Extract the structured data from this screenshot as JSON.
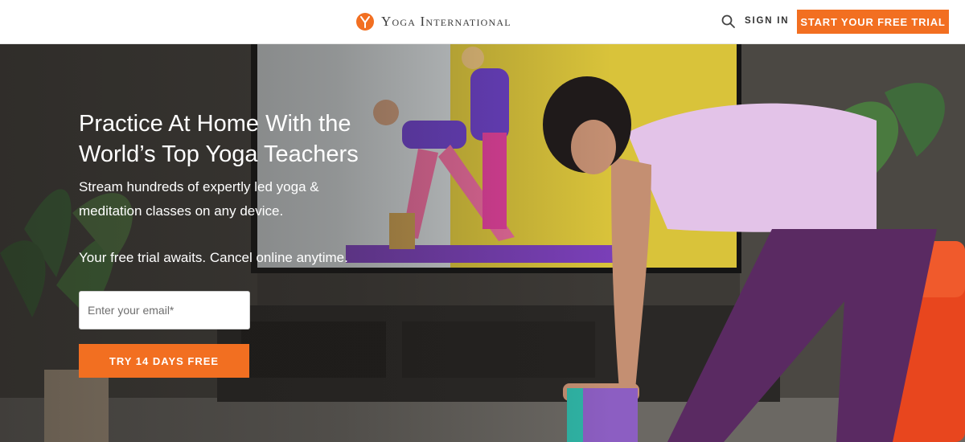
{
  "header": {
    "brand": "Yoga International",
    "sign_in_label": "SIGN IN",
    "trial_button_label": "START YOUR FREE TRIAL"
  },
  "hero": {
    "title": "Practice At Home With the World’s Top Yoga Teachers",
    "subtitle": "Stream hundreds of expertly led yoga & meditation classes on any device.",
    "trial_note": "Your free trial awaits. Cancel online anytime.",
    "email_placeholder": "Enter your email*",
    "cta_label": "TRY 14 DAYS FREE"
  },
  "colors": {
    "accent": "#f26f21",
    "text_dark": "#333333",
    "header_bg": "#ffffff"
  },
  "icons": {
    "logo": "yoga-international-logo",
    "search": "search-icon"
  }
}
